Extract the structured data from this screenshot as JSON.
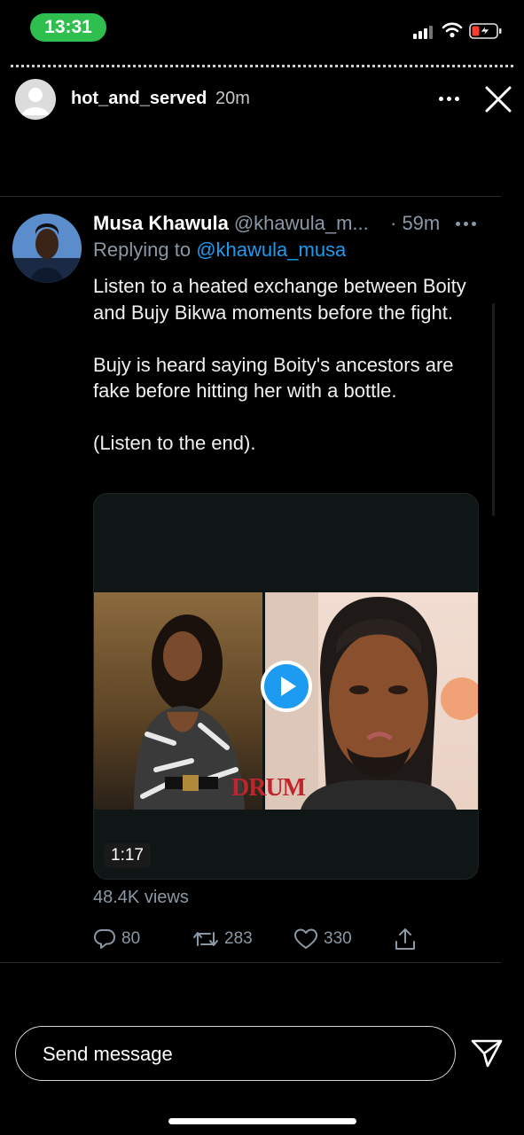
{
  "status_bar": {
    "time": "13:31",
    "time_pill_color": "#2fbf4f"
  },
  "story": {
    "username": "hot_and_served",
    "age": "20m"
  },
  "tweet": {
    "author_name": "Musa Khawula",
    "author_handle": "@khawula_m...",
    "age": "· 59m",
    "replying_prefix": "Replying to",
    "replying_handle": "@khawula_musa",
    "paragraphs": [
      "Listen to a heated exchange between Boity and Bujy Bikwa moments before the fight.",
      "Bujy is heard saying Boity's ancestors are fake before hitting her with a bottle.",
      "(Listen to the end)."
    ],
    "media": {
      "duration": "1:17",
      "logo_text": "DRUM"
    },
    "views": "48.4K views",
    "stats": {
      "replies": "80",
      "retweets": "283",
      "likes": "330"
    },
    "accent_color": "#1d9bf0"
  },
  "message_bar": {
    "placeholder": "Send message"
  },
  "icons": [
    "signal-icon",
    "wifi-icon",
    "battery-icon",
    "more-icon",
    "close-icon",
    "play-icon",
    "reply-icon",
    "retweet-icon",
    "like-icon",
    "share-icon",
    "send-icon"
  ]
}
